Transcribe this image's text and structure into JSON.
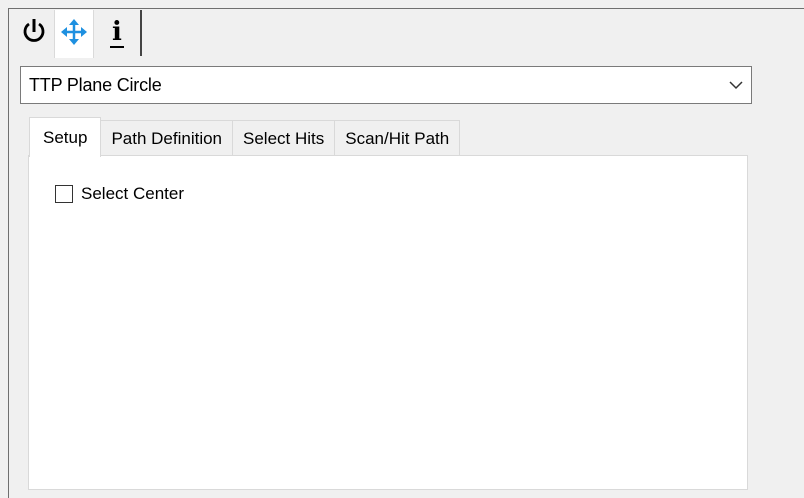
{
  "toolbar": {
    "icons": [
      {
        "name": "power-icon",
        "color": "#000000"
      },
      {
        "name": "move-arrows-icon",
        "color": "#1e90e0"
      },
      {
        "name": "info-icon",
        "glyph": "i",
        "color": "#000000"
      }
    ]
  },
  "feature_select": {
    "value": "TTP Plane Circle"
  },
  "tabs": [
    {
      "label": "Setup",
      "selected": true
    },
    {
      "label": "Path Definition",
      "selected": false
    },
    {
      "label": "Select Hits",
      "selected": false
    },
    {
      "label": "Scan/Hit Path",
      "selected": false
    }
  ],
  "setup": {
    "select_center": {
      "label": "Select Center",
      "checked": false
    }
  }
}
